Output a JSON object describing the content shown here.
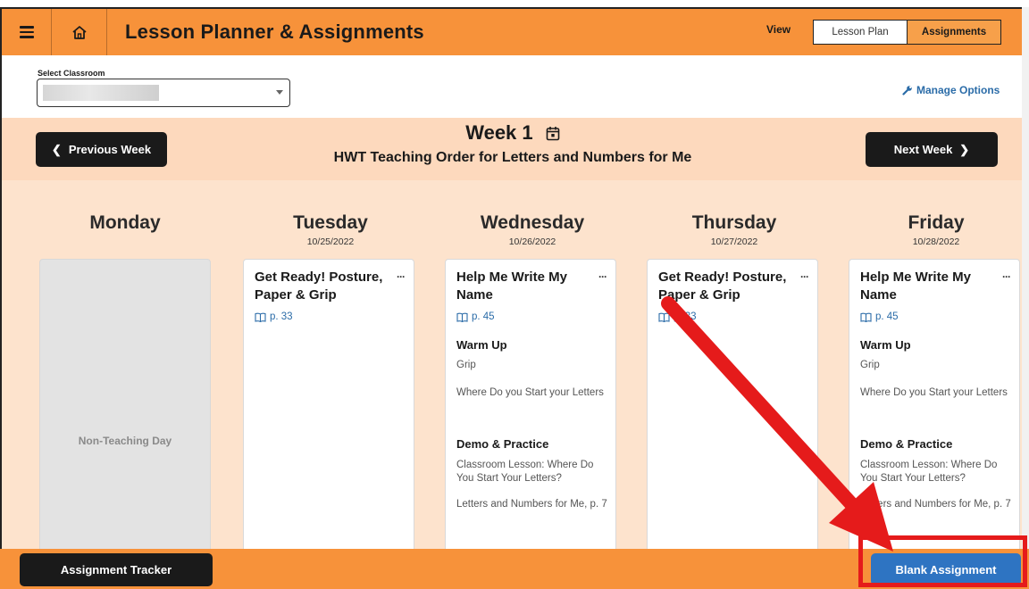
{
  "header": {
    "menu_icon": "hamburger-icon",
    "home_icon": "home-icon",
    "title": "Lesson Planner & Assignments",
    "view_label": "View",
    "view_options": [
      "Lesson Plan",
      "Assignments"
    ],
    "active_view": "Assignments"
  },
  "classroom": {
    "label": "Select Classroom",
    "selected_value": "",
    "manage_label": "Manage Options"
  },
  "week": {
    "title": "Week 1",
    "subtitle": "HWT Teaching Order for Letters and Numbers for Me",
    "prev_label": "Previous Week",
    "next_label": "Next Week"
  },
  "days": [
    {
      "name": "Monday",
      "date": "",
      "non_teaching_label": "Non-Teaching Day"
    },
    {
      "name": "Tuesday",
      "date": "10/25/2022",
      "lesson": {
        "title": "Get Ready! Posture, Paper & Grip",
        "more": "···",
        "page": "p. 33"
      }
    },
    {
      "name": "Wednesday",
      "date": "10/26/2022",
      "lesson": {
        "title": "Help Me Write My Name",
        "more": "···",
        "page": "p. 45",
        "sections": [
          {
            "title": "Warm Up",
            "items": [
              "Grip",
              "Where Do you Start your Letters"
            ]
          },
          {
            "title": "Demo & Practice",
            "items": [
              "Classroom Lesson: Where Do You Start Your Letters?",
              "Letters and Numbers for Me, p. 7"
            ]
          }
        ]
      }
    },
    {
      "name": "Thursday",
      "date": "10/27/2022",
      "lesson": {
        "title": "Get Ready! Posture, Paper & Grip",
        "more": "···",
        "page": "p. 33"
      }
    },
    {
      "name": "Friday",
      "date": "10/28/2022",
      "lesson": {
        "title": "Help Me Write My Name",
        "more": "···",
        "page": "p. 45",
        "sections": [
          {
            "title": "Warm Up",
            "items": [
              "Grip",
              "Where Do you Start your Letters"
            ]
          },
          {
            "title": "Demo & Practice",
            "items": [
              "Classroom Lesson: Where Do You Start Your Letters?",
              "Letters and Numbers for Me, p. 7"
            ]
          }
        ]
      }
    }
  ],
  "footer": {
    "tracker_label": "Assignment Tracker",
    "blank_label": "Blank Assignment"
  },
  "colors": {
    "header_orange": "#f7923a",
    "week_bar": "#fdd9bd",
    "main_bg": "#fde3cd",
    "link_blue": "#2b6ca8",
    "blank_button": "#2e74c2",
    "annotation_red": "#e51b1b"
  }
}
